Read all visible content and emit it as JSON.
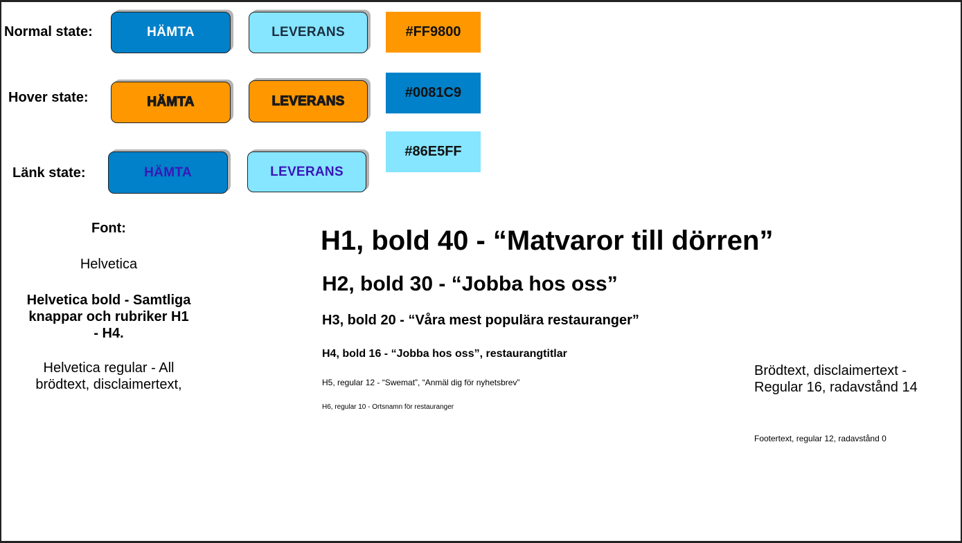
{
  "states": {
    "normal": "Normal state:",
    "hover": "Hover state:",
    "link": "Länk state:"
  },
  "buttons": {
    "hamta": "HÄMTA",
    "leverans": "LEVERANS"
  },
  "swatches": [
    "#FF9800",
    "#0081C9",
    "#86E5FF"
  ],
  "colors": {
    "orange": "#FF9800",
    "blue": "#0081C9",
    "light_blue": "#86E5FF"
  },
  "font_info": {
    "heading": "Font:",
    "font_name": "Helvetica",
    "bold_desc": "Helvetica bold - Samtliga knappar och rubriker H1 - H4.",
    "regular_desc": "Helvetica regular - All brödtext, disclaimertext,"
  },
  "typography": {
    "h1": "H1, bold 40 - “Matvaror till dörren”",
    "h2": "H2, bold 30 - “Jobba hos oss”",
    "h3": "H3, bold 20  - “Våra mest populära restauranger”",
    "h4": "H4, bold 16 - “Jobba hos oss”, restaurangtitlar",
    "h5": "H5, regular 12 - “Swemat”, “Anmäl dig för nyhetsbrev”",
    "h6": "H6, regular 10 - Ortsnamn för restauranger"
  },
  "body_text": {
    "brodtext": "Brödtext, disclaimertext - Regular 16, radavstånd 14",
    "footertext": "Footertext, regular 12, radavstånd 0"
  }
}
